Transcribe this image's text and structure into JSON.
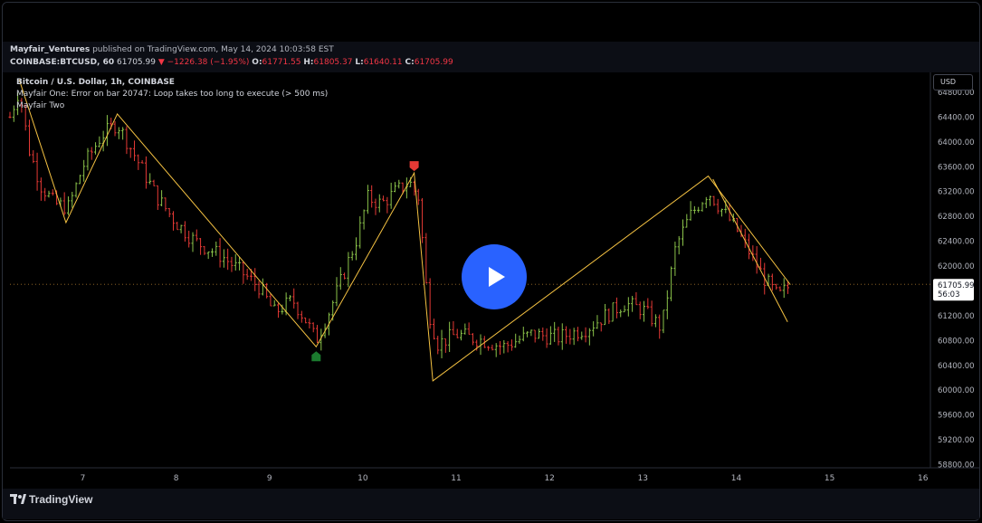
{
  "header": {
    "publisher": "Mayfair_Ventures",
    "published_text": " published on TradingView.com, May 14, 2024 10:03:58 EST",
    "symbol": "COINBASE:BTCUSD, 60",
    "last_price": "61705.99",
    "change": "−1226.38 (−1.95%)",
    "open_label": "O:",
    "open": "61771.55",
    "high_label": "H:",
    "high": "61805.37",
    "low_label": "L:",
    "low": "61640.11",
    "close_label": "C:",
    "close": "61705.99"
  },
  "legend": {
    "title": "Bitcoin / U.S. Dollar, 1h, COINBASE",
    "indicator1": "Mayfair One: Error on bar 20747: Loop takes too long to execute (> 500 ms)",
    "indicator2": "Mayfair Two"
  },
  "toolbar": {
    "currency": "USD"
  },
  "price_label": {
    "price": "61705.99",
    "countdown": "56:03"
  },
  "footer": {
    "brand": "TradingView"
  },
  "colors": {
    "background": "#000000",
    "up": "#8bc34a",
    "down": "#e53935",
    "zigzag": "#f5c242",
    "marker_top": "#e53935",
    "marker_bottom": "#1b7a2e",
    "play": "#2962ff"
  },
  "chart_data": {
    "type": "line",
    "title": "Bitcoin / U.S. Dollar, 1h, COINBASE",
    "xlabel": "",
    "ylabel": "",
    "x_ticks": [
      "7",
      "8",
      "9",
      "10",
      "11",
      "12",
      "13",
      "14",
      "15",
      "16"
    ],
    "y_ticks": [
      "64800.00",
      "64400.00",
      "64000.00",
      "63600.00",
      "63200.00",
      "62800.00",
      "62400.00",
      "62000.00",
      "61600.00",
      "61200.00",
      "60800.00",
      "60400.00",
      "60000.00",
      "59600.00",
      "59200.00",
      "58800.00"
    ],
    "ylim": [
      58750,
      65120
    ],
    "xlim": [
      6.22,
      16.08
    ],
    "grid": false,
    "last_price": 61705.99,
    "zigzag": [
      {
        "x": 6.32,
        "y": 65000
      },
      {
        "x": 6.82,
        "y": 62700
      },
      {
        "x": 7.37,
        "y": 64450
      },
      {
        "x": 9.5,
        "y": 60700
      },
      {
        "x": 10.55,
        "y": 63500
      },
      {
        "x": 10.75,
        "y": 60150
      },
      {
        "x": 13.7,
        "y": 63450
      },
      {
        "x": 14.58,
        "y": 61700
      }
    ],
    "zigzag2": [
      {
        "x": 13.75,
        "y": 63400
      },
      {
        "x": 14.55,
        "y": 61100
      }
    ],
    "markers": [
      {
        "type": "top",
        "x": 10.55,
        "y": 63500
      },
      {
        "type": "bottom",
        "x": 9.5,
        "y": 60700
      }
    ],
    "price_path": [
      {
        "x": 6.22,
        "y": 64400
      },
      {
        "x": 6.32,
        "y": 64850
      },
      {
        "x": 6.42,
        "y": 63900
      },
      {
        "x": 6.55,
        "y": 63300
      },
      {
        "x": 6.7,
        "y": 63000
      },
      {
        "x": 6.85,
        "y": 62950
      },
      {
        "x": 7.0,
        "y": 63600
      },
      {
        "x": 7.2,
        "y": 64100
      },
      {
        "x": 7.37,
        "y": 64300
      },
      {
        "x": 7.55,
        "y": 63800
      },
      {
        "x": 7.8,
        "y": 63100
      },
      {
        "x": 8.0,
        "y": 62700
      },
      {
        "x": 8.2,
        "y": 62400
      },
      {
        "x": 8.5,
        "y": 62150
      },
      {
        "x": 8.7,
        "y": 61900
      },
      {
        "x": 8.9,
        "y": 61650
      },
      {
        "x": 9.05,
        "y": 61250
      },
      {
        "x": 9.25,
        "y": 61450
      },
      {
        "x": 9.4,
        "y": 61100
      },
      {
        "x": 9.5,
        "y": 60800
      },
      {
        "x": 9.65,
        "y": 61300
      },
      {
        "x": 9.8,
        "y": 61900
      },
      {
        "x": 9.95,
        "y": 62500
      },
      {
        "x": 10.05,
        "y": 63100
      },
      {
        "x": 10.2,
        "y": 63000
      },
      {
        "x": 10.35,
        "y": 63200
      },
      {
        "x": 10.5,
        "y": 63350
      },
      {
        "x": 10.6,
        "y": 63100
      },
      {
        "x": 10.7,
        "y": 61300
      },
      {
        "x": 10.8,
        "y": 60750
      },
      {
        "x": 11.0,
        "y": 60900
      },
      {
        "x": 11.3,
        "y": 60800
      },
      {
        "x": 11.5,
        "y": 60700
      },
      {
        "x": 11.8,
        "y": 60900
      },
      {
        "x": 12.1,
        "y": 60850
      },
      {
        "x": 12.4,
        "y": 61000
      },
      {
        "x": 12.6,
        "y": 61200
      },
      {
        "x": 12.8,
        "y": 61400
      },
      {
        "x": 13.0,
        "y": 61300
      },
      {
        "x": 13.2,
        "y": 61000
      },
      {
        "x": 13.35,
        "y": 62300
      },
      {
        "x": 13.5,
        "y": 62800
      },
      {
        "x": 13.7,
        "y": 63200
      },
      {
        "x": 13.85,
        "y": 62900
      },
      {
        "x": 14.0,
        "y": 62600
      },
      {
        "x": 14.15,
        "y": 62200
      },
      {
        "x": 14.3,
        "y": 61800
      },
      {
        "x": 14.45,
        "y": 61500
      },
      {
        "x": 14.58,
        "y": 61700
      }
    ]
  }
}
